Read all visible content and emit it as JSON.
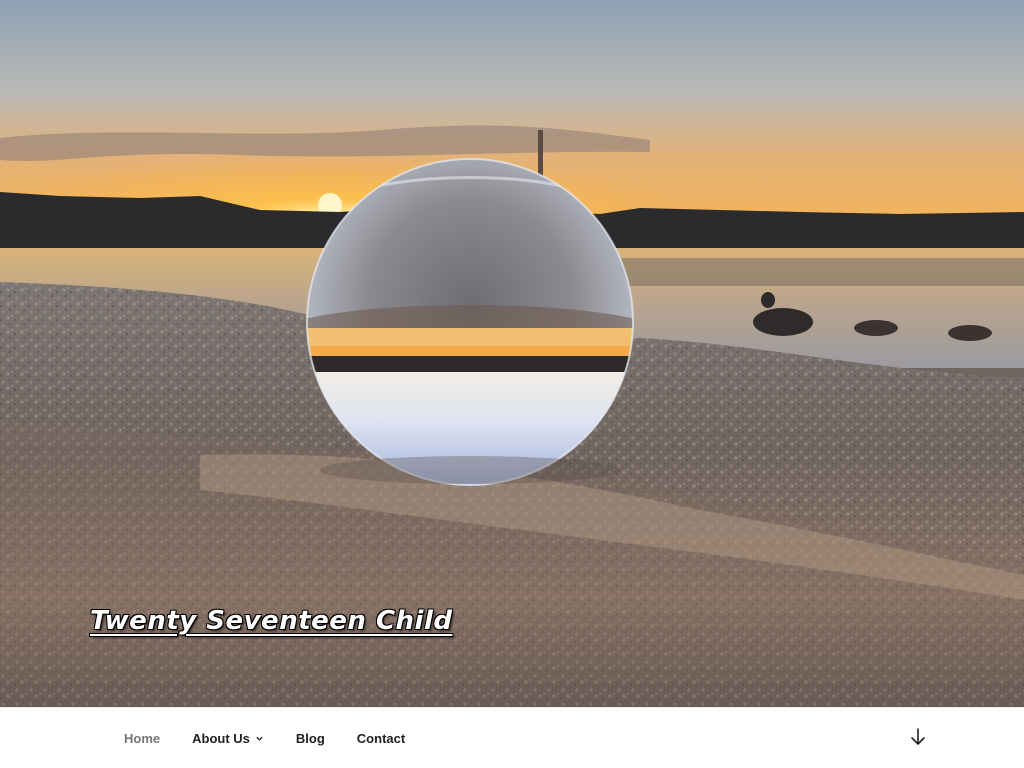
{
  "site": {
    "title": "Twenty Seventeen Child"
  },
  "header_image": {
    "description_icon": "crystal-ball-sunset-photo"
  },
  "navigation": {
    "items": [
      {
        "label": "Home",
        "current": true,
        "has_submenu": false
      },
      {
        "label": "About Us",
        "current": false,
        "has_submenu": true
      },
      {
        "label": "Blog",
        "current": false,
        "has_submenu": false
      },
      {
        "label": "Contact",
        "current": false,
        "has_submenu": false
      }
    ],
    "scroll_icon": "arrow-down-icon",
    "submenu_icon": "chevron-down-icon"
  },
  "colors": {
    "nav_text": "#222222",
    "nav_current": "#767676",
    "title_text": "#ffffff"
  }
}
